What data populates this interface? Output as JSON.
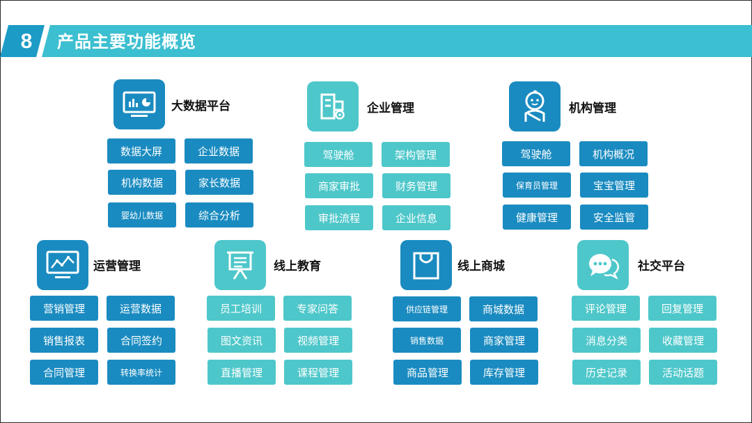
{
  "header": {
    "slide_number": "8",
    "title": "产品主要功能概览"
  },
  "colors": {
    "dark": "#1a8bc0",
    "light": "#4ec7ca",
    "banner": "#3cbfd0"
  },
  "groups": [
    {
      "title": "大数据平台",
      "icon": "monitor-chart-icon",
      "items": [
        "数据大屏",
        "企业数据",
        "机构数据",
        "家长数据",
        "婴幼儿数据",
        "综合分析"
      ]
    },
    {
      "title": "企业管理",
      "icon": "building-gear-icon",
      "items": [
        "驾驶舱",
        "架构管理",
        "商家审批",
        "财务管理",
        "审批流程",
        "企业信息"
      ]
    },
    {
      "title": "机构管理",
      "icon": "baby-icon",
      "items": [
        "驾驶舱",
        "机构概况",
        "保育员管理",
        "宝宝管理",
        "健康管理",
        "安全监管"
      ]
    },
    {
      "title": "运营管理",
      "icon": "line-chart-monitor-icon",
      "items": [
        "营销管理",
        "运营数据",
        "销售报表",
        "合同签约",
        "合同管理",
        "转换率统计"
      ]
    },
    {
      "title": "线上教育",
      "icon": "presentation-board-icon",
      "items": [
        "员工培训",
        "专家问答",
        "图文资讯",
        "视频管理",
        "直播管理",
        "课程管理"
      ]
    },
    {
      "title": "线上商城",
      "icon": "shopping-bag-icon",
      "items": [
        "供应链管理",
        "商城数据",
        "销售数据",
        "商家管理",
        "商品管理",
        "库存管理"
      ]
    },
    {
      "title": "社交平台",
      "icon": "chat-bubbles-icon",
      "items": [
        "评论管理",
        "回复管理",
        "消息分类",
        "收藏管理",
        "历史记录",
        "活动话题"
      ]
    }
  ]
}
